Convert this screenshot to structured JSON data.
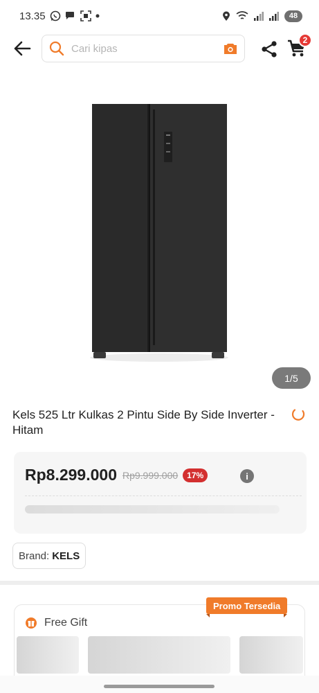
{
  "status_bar": {
    "time": "13.35",
    "battery": "48"
  },
  "header": {
    "search_placeholder": "Cari kipas",
    "cart_count": "2"
  },
  "gallery": {
    "counter": "1/5"
  },
  "product": {
    "title": "Kels 525 Ltr Kulkas 2 Pintu Side By Side Inverter - Hitam",
    "price": "Rp8.299.000",
    "original_price": "Rp9.999.000",
    "discount": "17%",
    "brand_label": "Brand:",
    "brand_value": "KELS"
  },
  "promo": {
    "tag": "Promo Tersedia",
    "title": "Free Gift"
  },
  "colors": {
    "accent": "#f07b2a",
    "discount": "#d32f2f"
  }
}
